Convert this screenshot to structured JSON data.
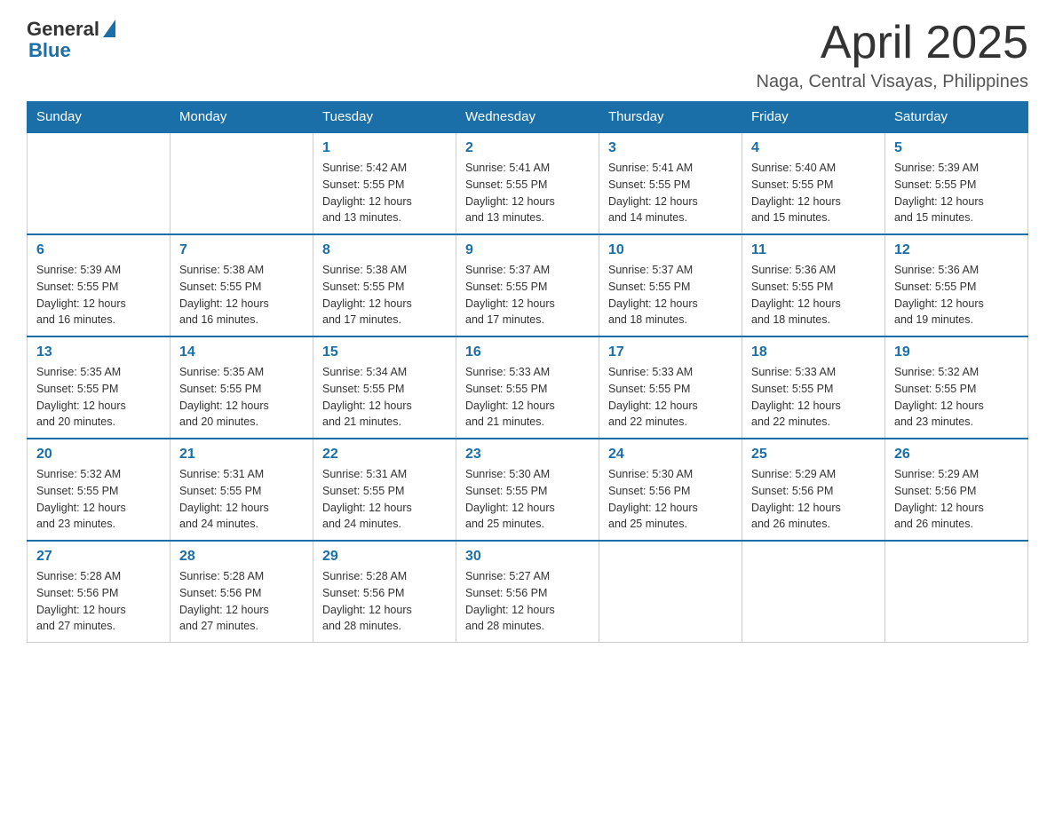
{
  "header": {
    "logo_general": "General",
    "logo_blue": "Blue",
    "title": "April 2025",
    "location": "Naga, Central Visayas, Philippines"
  },
  "days_of_week": [
    "Sunday",
    "Monday",
    "Tuesday",
    "Wednesday",
    "Thursday",
    "Friday",
    "Saturday"
  ],
  "weeks": [
    [
      {
        "day": "",
        "info": ""
      },
      {
        "day": "",
        "info": ""
      },
      {
        "day": "1",
        "info": "Sunrise: 5:42 AM\nSunset: 5:55 PM\nDaylight: 12 hours\nand 13 minutes."
      },
      {
        "day": "2",
        "info": "Sunrise: 5:41 AM\nSunset: 5:55 PM\nDaylight: 12 hours\nand 13 minutes."
      },
      {
        "day": "3",
        "info": "Sunrise: 5:41 AM\nSunset: 5:55 PM\nDaylight: 12 hours\nand 14 minutes."
      },
      {
        "day": "4",
        "info": "Sunrise: 5:40 AM\nSunset: 5:55 PM\nDaylight: 12 hours\nand 15 minutes."
      },
      {
        "day": "5",
        "info": "Sunrise: 5:39 AM\nSunset: 5:55 PM\nDaylight: 12 hours\nand 15 minutes."
      }
    ],
    [
      {
        "day": "6",
        "info": "Sunrise: 5:39 AM\nSunset: 5:55 PM\nDaylight: 12 hours\nand 16 minutes."
      },
      {
        "day": "7",
        "info": "Sunrise: 5:38 AM\nSunset: 5:55 PM\nDaylight: 12 hours\nand 16 minutes."
      },
      {
        "day": "8",
        "info": "Sunrise: 5:38 AM\nSunset: 5:55 PM\nDaylight: 12 hours\nand 17 minutes."
      },
      {
        "day": "9",
        "info": "Sunrise: 5:37 AM\nSunset: 5:55 PM\nDaylight: 12 hours\nand 17 minutes."
      },
      {
        "day": "10",
        "info": "Sunrise: 5:37 AM\nSunset: 5:55 PM\nDaylight: 12 hours\nand 18 minutes."
      },
      {
        "day": "11",
        "info": "Sunrise: 5:36 AM\nSunset: 5:55 PM\nDaylight: 12 hours\nand 18 minutes."
      },
      {
        "day": "12",
        "info": "Sunrise: 5:36 AM\nSunset: 5:55 PM\nDaylight: 12 hours\nand 19 minutes."
      }
    ],
    [
      {
        "day": "13",
        "info": "Sunrise: 5:35 AM\nSunset: 5:55 PM\nDaylight: 12 hours\nand 20 minutes."
      },
      {
        "day": "14",
        "info": "Sunrise: 5:35 AM\nSunset: 5:55 PM\nDaylight: 12 hours\nand 20 minutes."
      },
      {
        "day": "15",
        "info": "Sunrise: 5:34 AM\nSunset: 5:55 PM\nDaylight: 12 hours\nand 21 minutes."
      },
      {
        "day": "16",
        "info": "Sunrise: 5:33 AM\nSunset: 5:55 PM\nDaylight: 12 hours\nand 21 minutes."
      },
      {
        "day": "17",
        "info": "Sunrise: 5:33 AM\nSunset: 5:55 PM\nDaylight: 12 hours\nand 22 minutes."
      },
      {
        "day": "18",
        "info": "Sunrise: 5:33 AM\nSunset: 5:55 PM\nDaylight: 12 hours\nand 22 minutes."
      },
      {
        "day": "19",
        "info": "Sunrise: 5:32 AM\nSunset: 5:55 PM\nDaylight: 12 hours\nand 23 minutes."
      }
    ],
    [
      {
        "day": "20",
        "info": "Sunrise: 5:32 AM\nSunset: 5:55 PM\nDaylight: 12 hours\nand 23 minutes."
      },
      {
        "day": "21",
        "info": "Sunrise: 5:31 AM\nSunset: 5:55 PM\nDaylight: 12 hours\nand 24 minutes."
      },
      {
        "day": "22",
        "info": "Sunrise: 5:31 AM\nSunset: 5:55 PM\nDaylight: 12 hours\nand 24 minutes."
      },
      {
        "day": "23",
        "info": "Sunrise: 5:30 AM\nSunset: 5:55 PM\nDaylight: 12 hours\nand 25 minutes."
      },
      {
        "day": "24",
        "info": "Sunrise: 5:30 AM\nSunset: 5:56 PM\nDaylight: 12 hours\nand 25 minutes."
      },
      {
        "day": "25",
        "info": "Sunrise: 5:29 AM\nSunset: 5:56 PM\nDaylight: 12 hours\nand 26 minutes."
      },
      {
        "day": "26",
        "info": "Sunrise: 5:29 AM\nSunset: 5:56 PM\nDaylight: 12 hours\nand 26 minutes."
      }
    ],
    [
      {
        "day": "27",
        "info": "Sunrise: 5:28 AM\nSunset: 5:56 PM\nDaylight: 12 hours\nand 27 minutes."
      },
      {
        "day": "28",
        "info": "Sunrise: 5:28 AM\nSunset: 5:56 PM\nDaylight: 12 hours\nand 27 minutes."
      },
      {
        "day": "29",
        "info": "Sunrise: 5:28 AM\nSunset: 5:56 PM\nDaylight: 12 hours\nand 28 minutes."
      },
      {
        "day": "30",
        "info": "Sunrise: 5:27 AM\nSunset: 5:56 PM\nDaylight: 12 hours\nand 28 minutes."
      },
      {
        "day": "",
        "info": ""
      },
      {
        "day": "",
        "info": ""
      },
      {
        "day": "",
        "info": ""
      }
    ]
  ]
}
